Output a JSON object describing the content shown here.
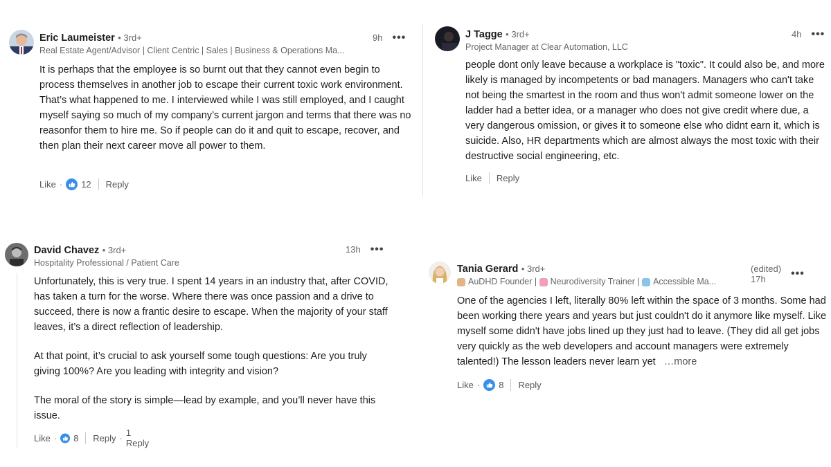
{
  "comments": [
    {
      "author": "Eric Laumeister",
      "degree": "• 3rd+",
      "headline": "Real Estate Agent/Advisor | Client Centric | Sales | Business & Operations Ma...",
      "time": "9h",
      "menu": "•••",
      "body": "It is perhaps that the employee is so burnt out that they cannot even begin to process themselves in another job to escape their current toxic work environment. That’s what happened to me. I interviewed while I was still employed, and I caught myself saying so much of my company’s current jargon and terms that there was no reasonfor them to hire me. So if people can do it and quit to escape, recover, and then plan their next career move all power to them.",
      "like_label": "Like",
      "reaction_count": "12",
      "reply_label": "Reply"
    },
    {
      "author": "J Tagge",
      "degree": "• 3rd+",
      "headline": "Project Manager at Clear Automation, LLC",
      "time": "4h",
      "menu": "•••",
      "body": "people dont only leave because a workplace is \"toxic\". It could also be, and more likely is managed by incompetents or bad managers. Managers who can't take not being the smartest in the room and thus won't admit someone lower on the ladder had a better idea, or a manager who does not give credit where due, a very dangerous omission, or gives it to someone else who didnt earn it, which is suicide. Also, HR departments which are almost always the most toxic with their destructive social engineering, etc.",
      "like_label": "Like",
      "reply_label": "Reply"
    },
    {
      "author": "David Chavez",
      "degree": "• 3rd+",
      "headline": "Hospitality Professional / Patient Care",
      "time": "13h",
      "menu": "•••",
      "paragraphs": [
        "Unfortunately, this is very true. I spent 14 years in an industry that, after COVID, has taken a turn for the worse. Where there was once passion and a drive to succeed, there is now a frantic desire to escape. When the majority of your staff leaves, it’s a direct reflection of leadership.",
        "At that point, it’s crucial to ask yourself some tough questions: Are you truly giving 100%? Are you leading with integrity and vision?",
        "The moral of the story is simple—lead by example, and you’ll never have this issue."
      ],
      "like_label": "Like",
      "reaction_count": "8",
      "reply_label": "Reply",
      "replies_label": "1 Reply"
    },
    {
      "author": "Tania Gerard",
      "degree": "• 3rd+",
      "headline_parts": [
        "AuDHD Founder |",
        "Neurodiversity Trainer |",
        "Accessible Ma..."
      ],
      "time": "(edited) 17h",
      "menu": "•••",
      "body": "One of the agencies I left, literally 80% left within the space of 3 months. Some had been working there years and years but just couldn't do it anymore like myself. Like myself some didn't have jobs lined up they just had to leave. (They did all get jobs very quickly as the web developers and account managers were extremely talented!) The lesson leaders never learn yet",
      "see_more": "…more",
      "like_label": "Like",
      "reaction_count": "8",
      "reply_label": "Reply"
    }
  ],
  "icons": {
    "reaction": "thumbs-up-icon",
    "menu": "ellipsis-icon",
    "accent": "#378fe9"
  }
}
